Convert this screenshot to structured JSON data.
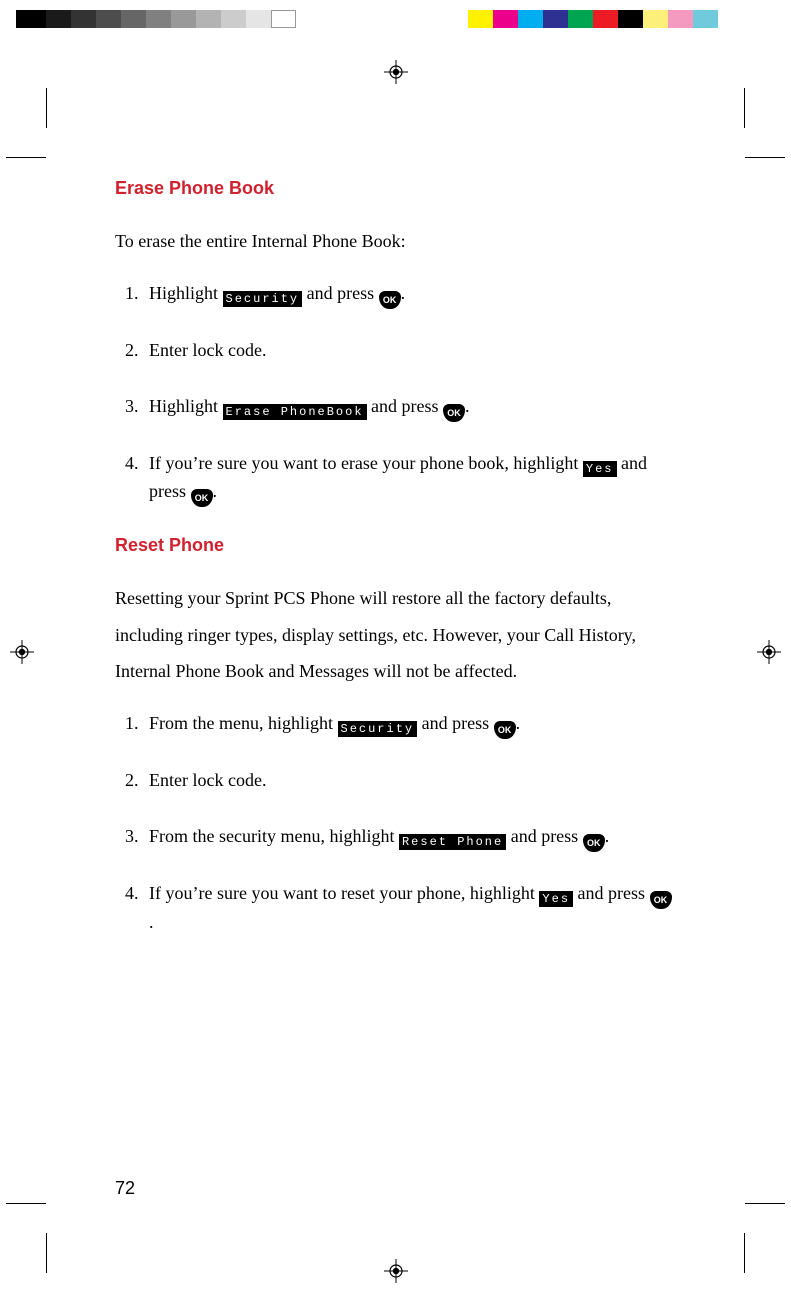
{
  "page_number": "72",
  "buttons": {
    "ok": "OK"
  },
  "menu_labels": {
    "security": "Security",
    "erase_phonebook": "Erase PhoneBook",
    "yes": "Yes",
    "reset_phone": "Reset Phone"
  },
  "sections": {
    "erase": {
      "title": "Erase Phone Book",
      "intro": "To erase the entire Internal Phone Book:",
      "steps": {
        "s1a": "Highlight ",
        "s1b": " and press ",
        "s1c": ".",
        "s2": "Enter lock code.",
        "s3a": "Highlight ",
        "s3b": " and press ",
        "s3c": ".",
        "s4a": "If you’re sure you want to erase your phone book, highlight ",
        "s4b": " and press ",
        "s4c": "."
      }
    },
    "reset": {
      "title": "Reset Phone",
      "intro": "Resetting your Sprint PCS Phone will restore all the factory defaults, including ringer types, display settings, etc. However, your Call History, Internal Phone Book and Messages will not be affected.",
      "steps": {
        "s1a": "From the menu, highlight ",
        "s1b": " and press ",
        "s1c": ".",
        "s2": "Enter lock code.",
        "s3a": "From the security menu, highlight ",
        "s3b": " and press ",
        "s3c": ".",
        "s4a": "If you’re sure you want to reset your phone, highlight ",
        "s4b": " and press ",
        "s4c": "."
      }
    }
  }
}
